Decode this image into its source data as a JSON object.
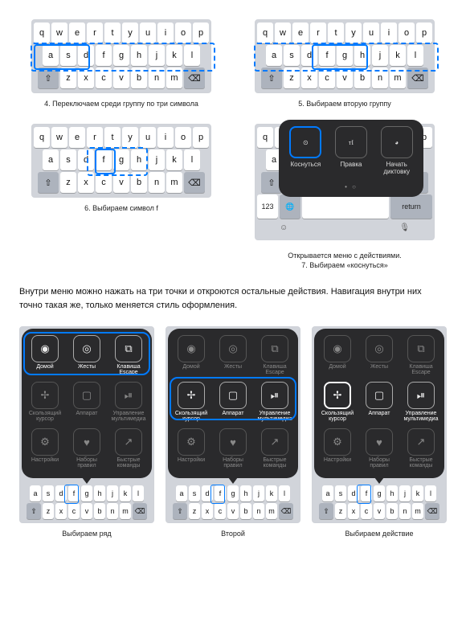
{
  "keyboard": {
    "row1": [
      "q",
      "w",
      "e",
      "r",
      "t",
      "y",
      "u",
      "i",
      "o",
      "p"
    ],
    "row2": [
      "a",
      "s",
      "d",
      "f",
      "g",
      "h",
      "j",
      "k",
      "l"
    ],
    "row3": [
      "z",
      "x",
      "c",
      "v",
      "b",
      "n",
      "m"
    ],
    "shift": "⇧",
    "backspace": "⌫",
    "nums": "123",
    "globe": "🌐",
    "mic": "🎤",
    "return": "return"
  },
  "captions": {
    "c4": "4. Переключаем среди группу по три символа",
    "c5": "5. Выбираем вторую группу",
    "c6": "6. Выбираем символ f",
    "c7a": "Открывается меню с действиями.",
    "c7b": "7. Выбираем «коснуться»",
    "body": "Внутри меню можно нажать на три точки и откроются остальные действия. Навигация внутри них точно такая же, только меняется стиль оформления.",
    "b1": "Выбираем ряд",
    "b2": "Второй",
    "b3": "Выбираем действие"
  },
  "action_menu": {
    "tap": "Коснуться",
    "edit": "Правка",
    "dictate": "Начать диктовку"
  },
  "big_menu": {
    "items": [
      {
        "label": "Домой",
        "icon": "◉"
      },
      {
        "label": "Жесты",
        "icon": "◎"
      },
      {
        "label": "Клавиша Escape",
        "icon": "⧉"
      },
      {
        "label": "Скользящий курсор",
        "icon": "✢"
      },
      {
        "label": "Аппарат",
        "icon": "▢"
      },
      {
        "label": "Управление мультимедиа",
        "icon": "⏯"
      },
      {
        "label": "Настройки",
        "icon": "⚙"
      },
      {
        "label": "Наборы правил",
        "icon": "♥"
      },
      {
        "label": "Быстрые команды",
        "icon": "↗"
      }
    ]
  }
}
